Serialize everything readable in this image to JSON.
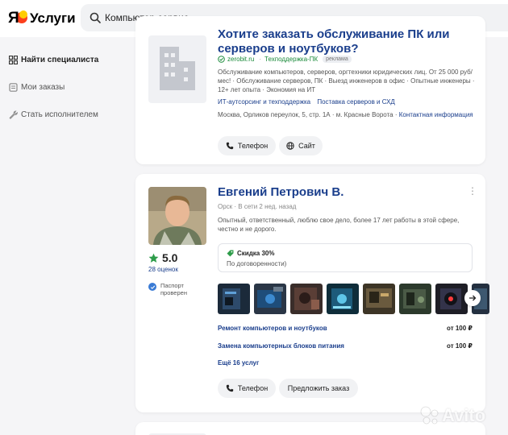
{
  "header": {
    "logo_text": "Услуги",
    "search_value": "Компьютер сервис"
  },
  "sidebar": {
    "items": [
      {
        "label": "Найти специалиста",
        "icon": "grid-icon"
      },
      {
        "label": "Мои заказы",
        "icon": "orders-icon"
      },
      {
        "label": "Стать исполнителем",
        "icon": "wrench-icon"
      }
    ]
  },
  "ad_card": {
    "title": "Хотите заказать обслуживание ПК или серверов и ноутбуков?",
    "site": "zerobit.ru",
    "category": "Техподдержка-ПК",
    "ad_label": "реклама",
    "description": "Обслуживание компьютеров, серверов, оргтехники юридических лиц. От 25 000 руб/мес! · Обслуживание серверов, ПК · Выезд инженеров в офис · Опытные инженеры · 12+ лет опыта · Экономия на ИТ",
    "links": [
      "ИТ-аутсорсинг и техподдержка",
      "Поставка серверов и СХД"
    ],
    "address": "Москва, Орликов переулок, 5, стр. 1А · м. Красные Ворота · ",
    "contact_link": "Контактная информация",
    "phone_button": "Телефон",
    "site_button": "Сайт"
  },
  "specialist_card": {
    "name": "Евгений Петрович В.",
    "location": "Орск",
    "status": "В сети 2 нед. назад",
    "description": "Опытный, ответственный, люблю свое дело, более 17 лет работы в этой сфере, честно и не дорого.",
    "rating": "5.0",
    "reviews": "28 оценок",
    "passport_line1": "Паспорт",
    "passport_line2": "проверен",
    "discount_title": "Скидка 30%",
    "discount_sub": "По договоренности)",
    "services": [
      {
        "name": "Ремонт компьютеров и ноутбуков",
        "price": "от 100 ₽"
      },
      {
        "name": "Замена компьютерных блоков питания",
        "price": "от 100 ₽"
      }
    ],
    "more_services": "Ещё 16 услуг",
    "phone_button": "Телефон",
    "offer_button": "Предложить заказ"
  },
  "watermark": "Avito",
  "colors": {
    "link_blue": "#1a3e8c",
    "green": "#1a8a3a",
    "background": "#f5f5f7",
    "star": "#2e9c4a"
  }
}
